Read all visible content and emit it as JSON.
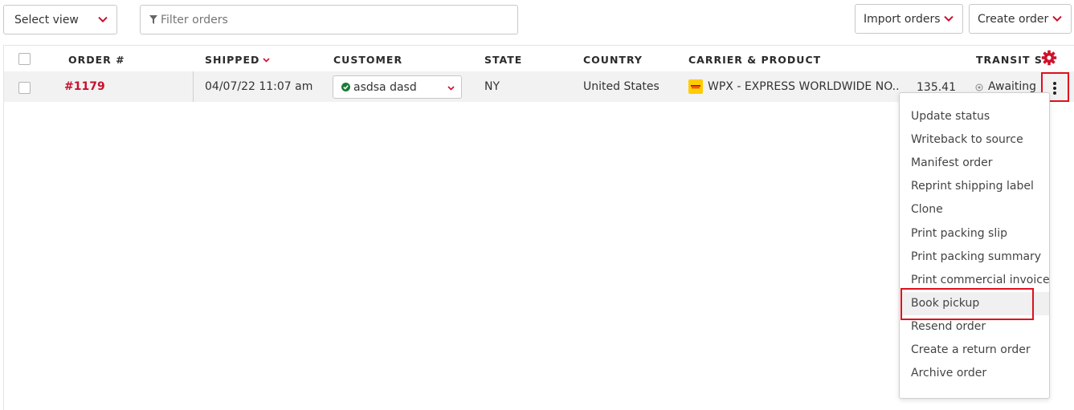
{
  "toolbar": {
    "select_view": "Select view",
    "filter_placeholder": "Filter orders",
    "import_orders": "Import orders",
    "create_order": "Create order"
  },
  "table": {
    "headers": {
      "order": "ORDER #",
      "shipped": "SHIPPED",
      "customer": "CUSTOMER",
      "state": "STATE",
      "country": "COUNTRY",
      "carrier": "CARRIER & PRODUCT",
      "transit": "TRANSIT ST"
    },
    "row": {
      "order_number": "#1179",
      "shipped": "04/07/22 11:07 am",
      "customer": "asdsa dasd",
      "state": "NY",
      "country": "United States",
      "carrier_product": "WPX - EXPRESS WORLDWIDE NO..",
      "amount": "135.41",
      "transit_status": "Awaiting s"
    }
  },
  "menu": {
    "items": [
      "Update status",
      "Writeback to source",
      "Manifest order",
      "Reprint shipping label",
      "Clone",
      "Print packing slip",
      "Print packing summary",
      "Print commercial invoice",
      "Book pickup",
      "Resend order",
      "Create a return order",
      "Archive order"
    ],
    "highlighted_index": 8
  },
  "colors": {
    "accent": "#c8102e",
    "highlight_box": "#e0101e",
    "carrier_badge": "#ffcc00",
    "success": "#1b7a3a"
  },
  "icons": {
    "filter": "filter-icon",
    "settings": "gear-icon",
    "more": "vertical-ellipsis-icon",
    "customer_status": "check-circle-icon",
    "carrier": "dhl-logo-icon"
  }
}
